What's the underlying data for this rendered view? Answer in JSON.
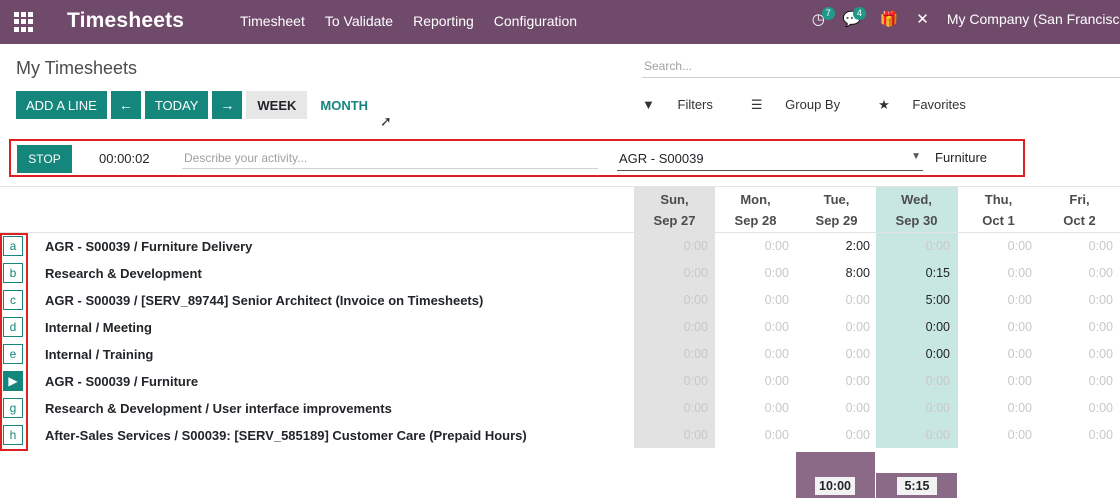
{
  "nav": {
    "brand": "Timesheets",
    "menu": [
      "Timesheet",
      "To Validate",
      "Reporting",
      "Configuration"
    ],
    "activity_badge": "7",
    "messages_badge": "4",
    "company": "My Company (San Francisco)"
  },
  "control": {
    "page_title": "My Timesheets",
    "search_placeholder": "Search...",
    "add_line": "ADD A LINE",
    "prev": "←",
    "today": "TODAY",
    "next": "→",
    "week": "WEEK",
    "month": "MONTH",
    "filters": "Filters",
    "group_by": "Group By",
    "favorites": "Favorites"
  },
  "timer": {
    "stop": "STOP",
    "elapsed": "00:00:02",
    "activity_placeholder": "Describe your activity...",
    "project": "AGR - S00039",
    "task": "Furniture"
  },
  "days": [
    {
      "l1": "Sun,",
      "l2": "Sep 27"
    },
    {
      "l1": "Mon,",
      "l2": "Sep 28"
    },
    {
      "l1": "Tue,",
      "l2": "Sep 29"
    },
    {
      "l1": "Wed,",
      "l2": "Sep 30"
    },
    {
      "l1": "Thu,",
      "l2": "Oct 1"
    },
    {
      "l1": "Fri,",
      "l2": "Oct 2"
    }
  ],
  "rows": [
    {
      "key": "a",
      "label": "AGR - S00039  /  Furniture Delivery",
      "cells": [
        "0:00",
        "0:00",
        "2:00",
        "0:00",
        "0:00",
        "0:00"
      ]
    },
    {
      "key": "b",
      "label": "Research & Development",
      "cells": [
        "0:00",
        "0:00",
        "8:00",
        "0:15",
        "0:00",
        "0:00"
      ]
    },
    {
      "key": "c",
      "label": "AGR - S00039  /  [SERV_89744] Senior Architect (Invoice on Timesheets)",
      "cells": [
        "0:00",
        "0:00",
        "0:00",
        "5:00",
        "0:00",
        "0:00"
      ]
    },
    {
      "key": "d",
      "label": "Internal  /  Meeting",
      "cells": [
        "0:00",
        "0:00",
        "0:00",
        "0:00",
        "0:00",
        "0:00"
      ]
    },
    {
      "key": "e",
      "label": "Internal  /  Training",
      "cells": [
        "0:00",
        "0:00",
        "0:00",
        "0:00",
        "0:00",
        "0:00"
      ]
    },
    {
      "key": "▶",
      "label": "AGR - S00039  /  Furniture",
      "cells": [
        "0:00",
        "0:00",
        "0:00",
        "0:00",
        "0:00",
        "0:00"
      ]
    },
    {
      "key": "g",
      "label": "Research & Development  /  User interface improvements",
      "cells": [
        "0:00",
        "0:00",
        "0:00",
        "0:00",
        "0:00",
        "0:00"
      ]
    },
    {
      "key": "h",
      "label": "After-Sales Services  /  S00039: [SERV_585189] Customer Care (Prepaid Hours)",
      "cells": [
        "0:00",
        "0:00",
        "0:00",
        "0:00",
        "0:00",
        "0:00"
      ]
    }
  ],
  "totals": {
    "tue": "10:00",
    "wed": "5:15"
  },
  "colors": {
    "nav": "#6f4a6a",
    "primary": "#15867b",
    "highlight": "#e02020",
    "today": "#c8e7e2"
  }
}
